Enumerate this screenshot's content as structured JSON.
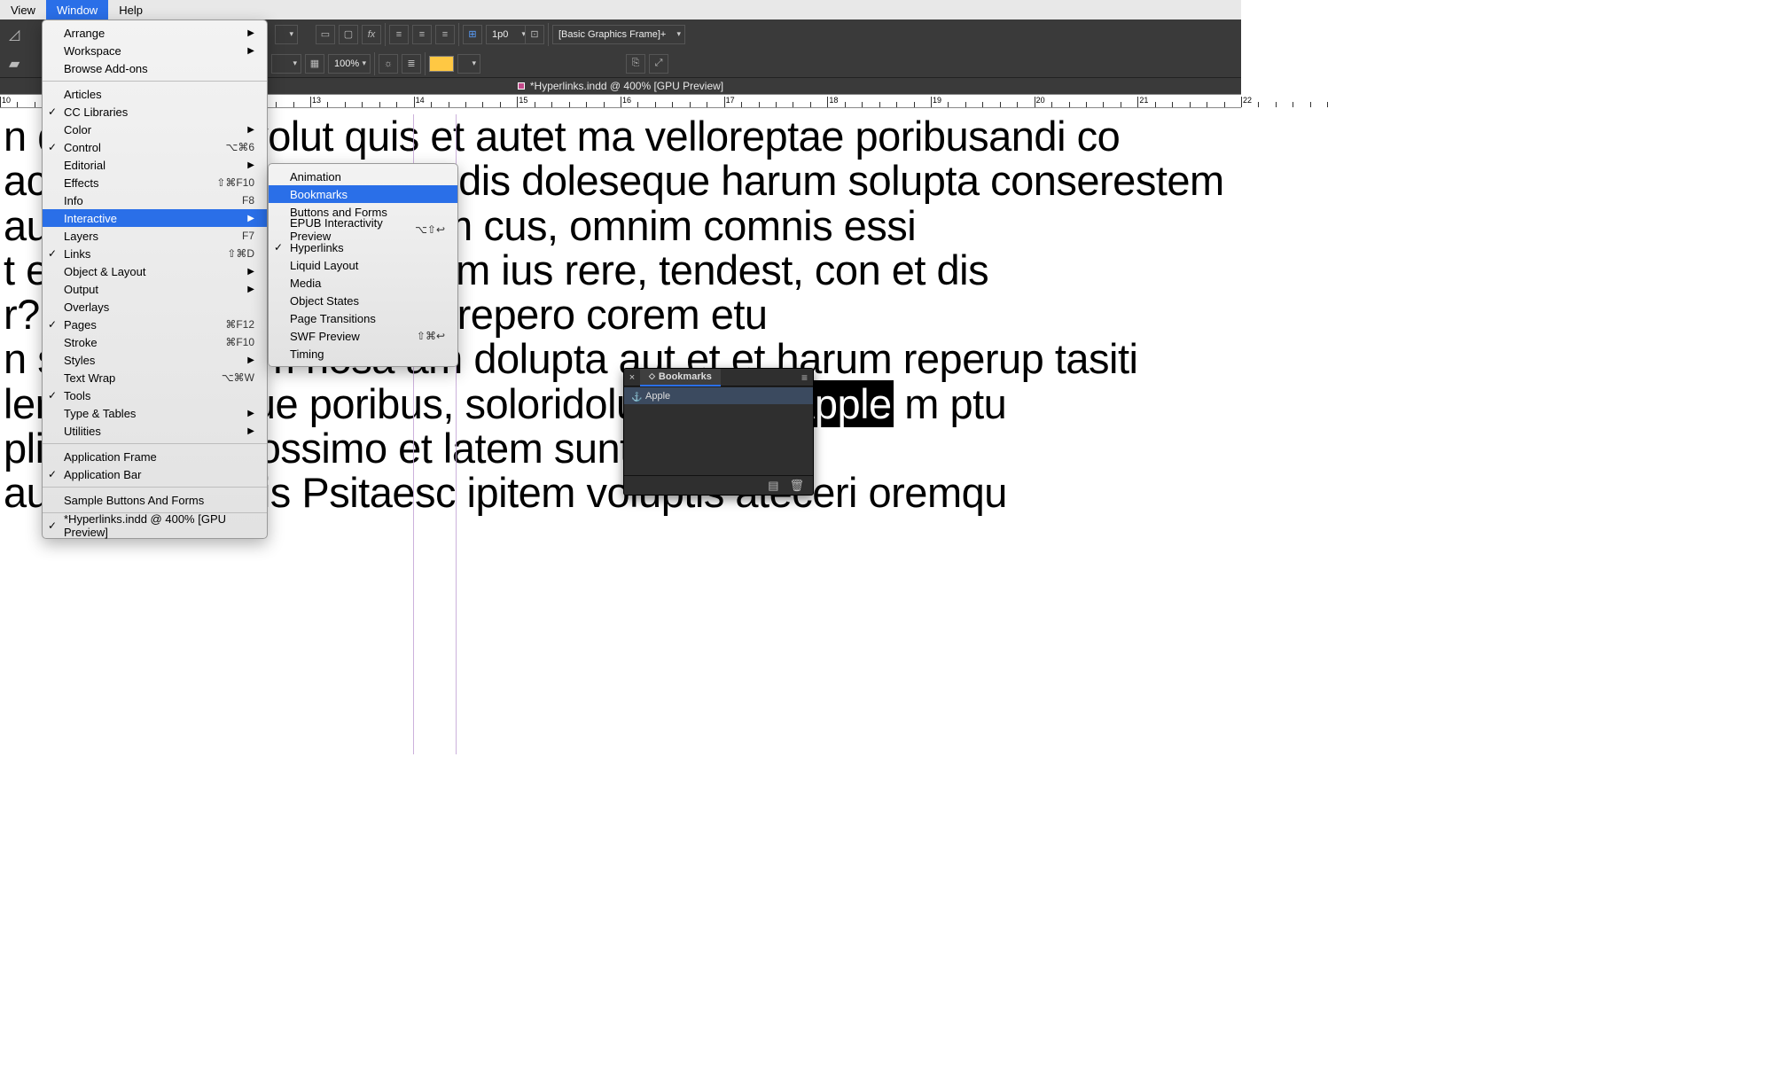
{
  "menubar": {
    "items": [
      "View",
      "Window",
      "Help"
    ],
    "selected_index": 1
  },
  "toolband": {
    "style_dropdown": "[Basic Graphics Frame]+",
    "zoom": "100%",
    "ruler_unit": "1p0"
  },
  "doc_tab": {
    "icon": "indd-icon",
    "title": "*Hyperlinks.indd @ 400% [GPU Preview]"
  },
  "ruler": {
    "start": 10,
    "end": 22
  },
  "doc_lines": [
    "n quia as aut volut quis et autet ma velloreptae poribusandi co",
    "acerum et eost esto essedis doleseque harum solupta conserestem ",
    " aut aut quuntius eum sam cus, omnim comnis essi",
    "t eaqui totae nonserae rem ius rere, tendest, con et dis ",
    "r?  dit voluptur a quia volorepero corem etu",
    "n solor rest, tem nosa am dolupta aut et et harum reperup tasiti",
    "lemquiaspis que poribus, soloridoluptatiur? |Apple| m ptu",
    "pliquid eicitat iossimo et latem sunt es u osa",
    " aut quam in this Psitaesc ipitem voluptis ateceri oremqu"
  ],
  "highlight_word": "Apple",
  "window_menu": {
    "groups": [
      [
        {
          "label": "Arrange",
          "arrow": true
        },
        {
          "label": "Workspace",
          "arrow": true
        },
        {
          "label": "Browse Add-ons"
        }
      ],
      [
        {
          "label": "Articles"
        },
        {
          "label": "CC Libraries",
          "checked": true
        },
        {
          "label": "Color",
          "arrow": true
        },
        {
          "label": "Control",
          "checked": true,
          "shortcut": "⌥⌘6"
        },
        {
          "label": "Editorial",
          "arrow": true
        },
        {
          "label": "Effects",
          "shortcut": "⇧⌘F10"
        },
        {
          "label": "Info",
          "shortcut": "F8"
        },
        {
          "label": "Interactive",
          "arrow": true,
          "selected": true
        },
        {
          "label": "Layers",
          "shortcut": "F7"
        },
        {
          "label": "Links",
          "checked": true,
          "shortcut": "⇧⌘D"
        },
        {
          "label": "Object & Layout",
          "arrow": true
        },
        {
          "label": "Output",
          "arrow": true
        },
        {
          "label": "Overlays"
        },
        {
          "label": "Pages",
          "checked": true,
          "shortcut": "⌘F12"
        },
        {
          "label": "Stroke",
          "shortcut": "⌘F10"
        },
        {
          "label": "Styles",
          "arrow": true
        },
        {
          "label": "Text Wrap",
          "shortcut": "⌥⌘W"
        },
        {
          "label": "Tools",
          "checked": true
        },
        {
          "label": "Type & Tables",
          "arrow": true
        },
        {
          "label": "Utilities",
          "arrow": true
        }
      ],
      [
        {
          "label": "Application Frame"
        },
        {
          "label": "Application Bar",
          "checked": true
        }
      ],
      [
        {
          "label": "Sample Buttons And Forms"
        }
      ],
      [
        {
          "label": "*Hyperlinks.indd @ 400% [GPU Preview]",
          "checked": true
        }
      ]
    ]
  },
  "interactive_submenu": [
    {
      "label": "Animation"
    },
    {
      "label": "Bookmarks",
      "selected": true
    },
    {
      "label": "Buttons and Forms"
    },
    {
      "label": "EPUB Interactivity Preview",
      "shortcut": "⌥⇧↩"
    },
    {
      "label": "Hyperlinks",
      "checked": true
    },
    {
      "label": "Liquid Layout"
    },
    {
      "label": "Media"
    },
    {
      "label": "Object States"
    },
    {
      "label": "Page Transitions"
    },
    {
      "label": "SWF Preview",
      "shortcut": "⇧⌘↩"
    },
    {
      "label": "Timing"
    }
  ],
  "bookmarks_panel": {
    "title": "Bookmarks",
    "items": [
      {
        "label": "Apple"
      }
    ]
  }
}
